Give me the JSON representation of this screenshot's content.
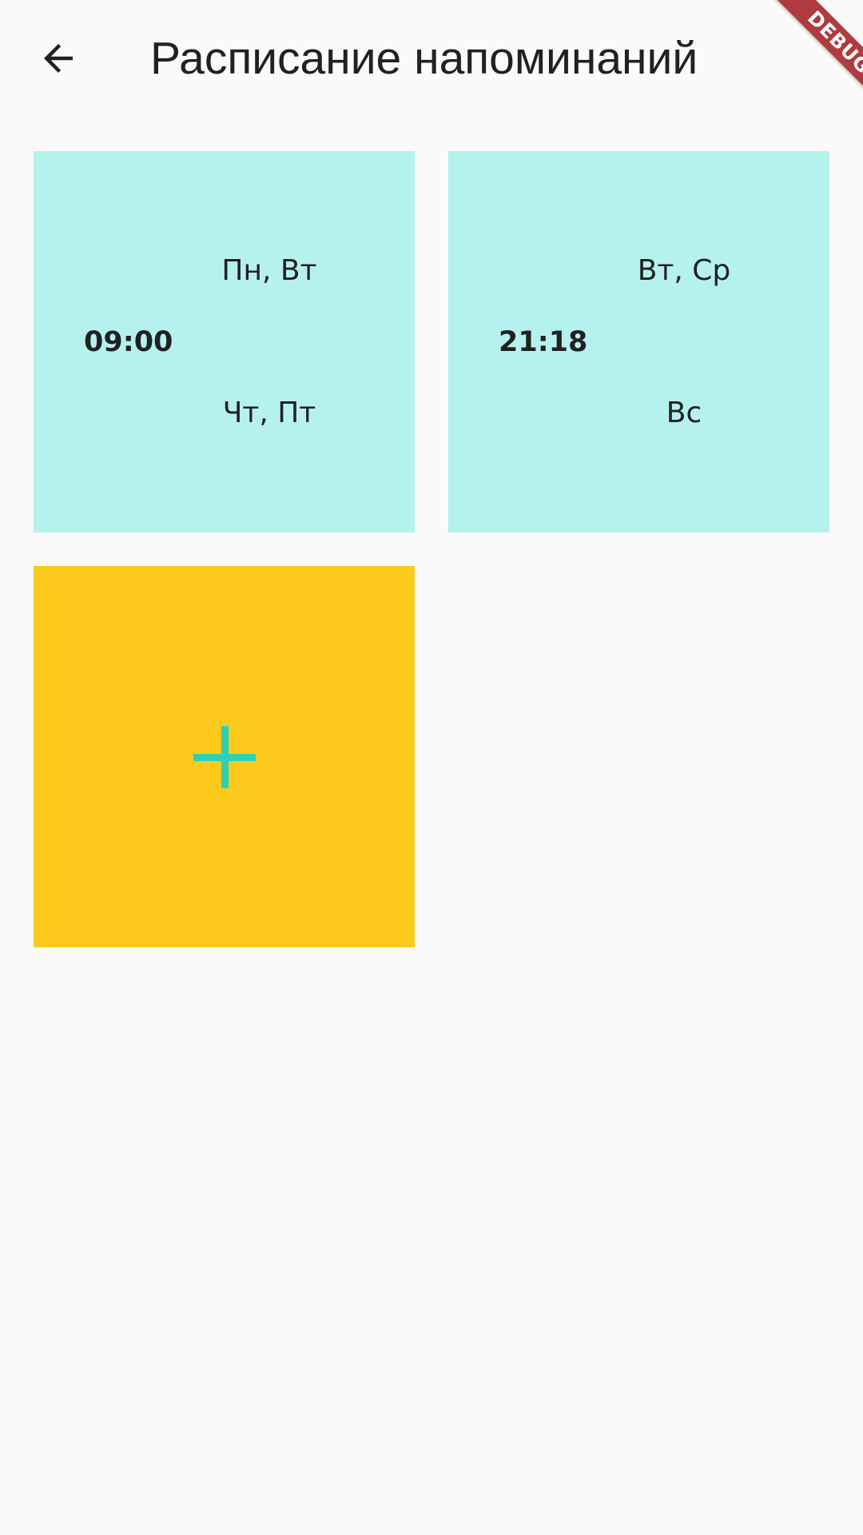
{
  "app_bar": {
    "title": "Расписание напоминаний",
    "back_icon": "arrow-back-icon"
  },
  "debug_banner": {
    "label": "DEBUG"
  },
  "reminders": [
    {
      "time": "09:00",
      "days_top": "Пн, Вт",
      "days_bottom": "Чт, Пт"
    },
    {
      "time": "21:18",
      "days_top": "Вт, Ср",
      "days_bottom": "Вс"
    }
  ],
  "add_card": {
    "icon": "plus-icon"
  },
  "colors": {
    "background": "#fafafa",
    "card": "#b5f2ee",
    "add_card": "#fcca1c",
    "plus": "#2fd1b4",
    "debug": "#b03a3f",
    "text": "#212121"
  }
}
